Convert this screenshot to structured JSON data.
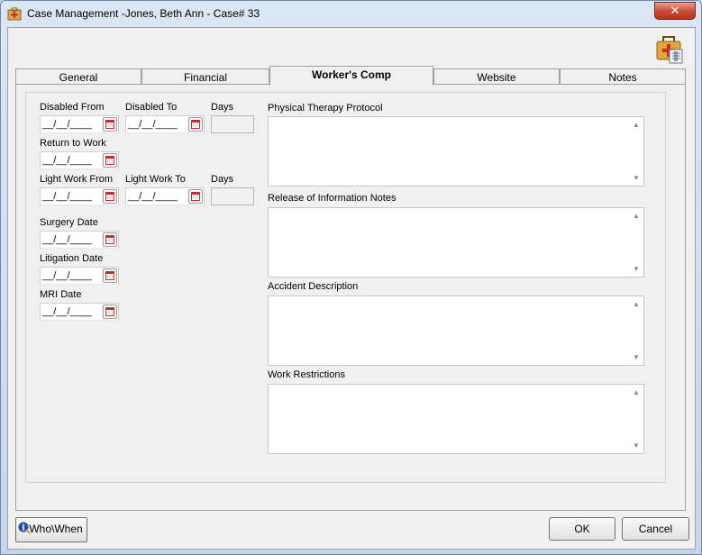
{
  "window": {
    "title": "Case Management -Jones, Beth Ann - Case#  33",
    "close_label": "✕"
  },
  "tabs": [
    {
      "label": "General",
      "active": false
    },
    {
      "label": "Financial",
      "active": false
    },
    {
      "label": "Worker's Comp",
      "active": true
    },
    {
      "label": "Website",
      "active": false
    },
    {
      "label": "Notes",
      "active": false
    }
  ],
  "fields": {
    "disabled_from": {
      "label": "Disabled From",
      "value": "__/__/____"
    },
    "disabled_to": {
      "label": "Disabled To",
      "value": "__/__/____"
    },
    "disabled_days": {
      "label": "Days",
      "value": ""
    },
    "return_to_work": {
      "label": "Return to Work",
      "value": "__/__/____"
    },
    "light_work_from": {
      "label": "Light Work From",
      "value": "__/__/____"
    },
    "light_work_to": {
      "label": "Light Work To",
      "value": "__/__/____"
    },
    "light_work_days": {
      "label": "Days",
      "value": ""
    },
    "surgery_date": {
      "label": "Surgery Date",
      "value": "__/__/____"
    },
    "litigation_date": {
      "label": "Litigation Date",
      "value": "__/__/____"
    },
    "mri_date": {
      "label": "MRI Date",
      "value": "__/__/____"
    }
  },
  "memos": {
    "physical_therapy": {
      "label": "Physical Therapy Protocol",
      "value": ""
    },
    "release_info": {
      "label": "Release of Information Notes",
      "value": ""
    },
    "accident": {
      "label": "Accident Description",
      "value": ""
    },
    "work_restrictions": {
      "label": "Work Restrictions",
      "value": ""
    }
  },
  "buttons": {
    "whowhen": "Who\\When",
    "ok": "OK",
    "cancel": "Cancel"
  },
  "icons": {
    "app": "case-management-icon",
    "corner": "medical-kit-icon",
    "calendar": "calendar-icon",
    "info": "info-icon"
  },
  "colors": {
    "close_button": "#c94a32",
    "calendar_red": "#cc2a2a",
    "title_bar": "#dbe7f5"
  }
}
